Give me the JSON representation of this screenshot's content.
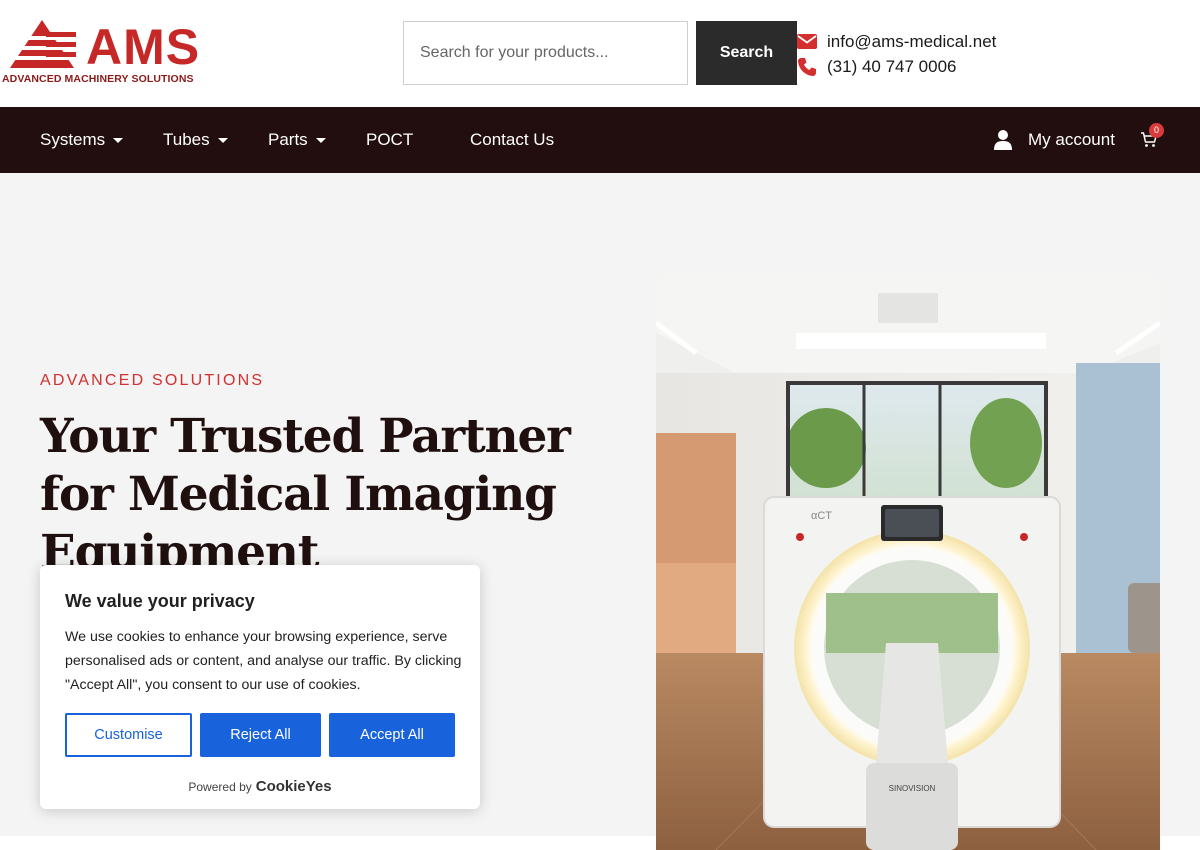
{
  "brand": {
    "name": "AMS",
    "tagline": "ADVANCED MACHINERY SOLUTIONS",
    "color": "#c62828"
  },
  "search": {
    "placeholder": "Search for your products...",
    "button_label": "Search"
  },
  "contact": {
    "email": "info@ams-medical.net",
    "phone": "(31) 40 747 0006",
    "icon_color": "#d32f2f"
  },
  "nav": {
    "items": [
      {
        "label": "Systems",
        "dropdown": true
      },
      {
        "label": "Tubes",
        "dropdown": true
      },
      {
        "label": "Parts",
        "dropdown": true
      },
      {
        "label": "POCT",
        "dropdown": false
      },
      {
        "label": "Contact Us",
        "dropdown": false
      }
    ],
    "account_label": "My account",
    "cart_count": "0",
    "background": "#220e0e"
  },
  "hero": {
    "eyebrow": "ADVANCED SOLUTIONS",
    "headline": "Your Trusted Partner for Medical Imaging Equipment",
    "image_alt": "CT scanner in a bright clinical room",
    "scanner_brand": "SINOVISION",
    "scanner_model": "αCT"
  },
  "cookie_banner": {
    "title": "We value your privacy",
    "text": "We use cookies to enhance your browsing experience, serve personalised ads or content, and analyse our traffic. By clicking \"Accept All\", you consent to our use of cookies.",
    "customise_label": "Customise",
    "reject_label": "Reject All",
    "accept_label": "Accept All",
    "powered_by": "Powered by",
    "powered_brand": "CookieYes",
    "accent": "#1863dc"
  }
}
